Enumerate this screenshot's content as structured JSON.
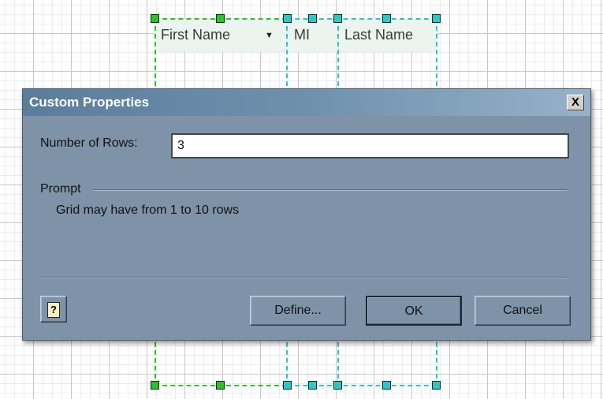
{
  "canvas": {
    "grid_columns": [
      "First Name",
      "MI",
      "Last Name"
    ],
    "dropdown_icon": "triangle-down"
  },
  "dialog": {
    "title": "Custom Properties",
    "close_label": "X",
    "number_of_rows": {
      "label": "Number of Rows:",
      "value": "3"
    },
    "prompt": {
      "label": "Prompt",
      "text": "Grid may have from 1 to 10 rows"
    },
    "buttons": {
      "help": "?",
      "define": "Define...",
      "ok": "OK",
      "cancel": "Cancel"
    }
  },
  "colors": {
    "dialog_body": "#7f93a8",
    "titlebar_start": "#5b7d9c",
    "titlebar_end": "#95b2c9",
    "handle_green": "#2cc02c",
    "handle_cyan": "#2cc8c8"
  }
}
